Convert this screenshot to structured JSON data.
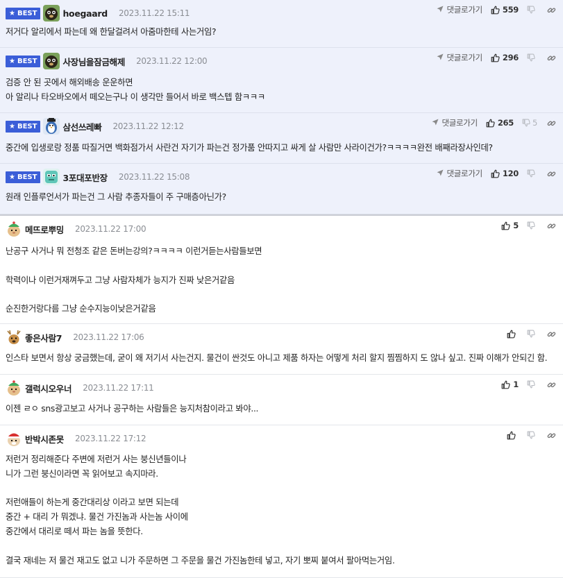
{
  "reply_label": "댓글로가기",
  "best_label": "BEST",
  "comments": [
    {
      "best": true,
      "nick": "hoegaard",
      "time": "2023.11.22 15:11",
      "likes": "559",
      "dislikes": "",
      "avatar": "dog-black",
      "lines": [
        "저거다 알리에서 파는데 왜 한달걸려서 아줌마한테 사는거임?"
      ]
    },
    {
      "best": true,
      "nick": "사장님을잠금해제",
      "time": "2023.11.22 12:00",
      "likes": "296",
      "dislikes": "",
      "avatar": "dog-black",
      "lines": [
        "검증 안 된 곳에서 해외배송 운운하면",
        "아 알리나 타오바오에서 떼오는구나 이 생각만 들어서 바로 백스텝 함ㅋㅋㅋ"
      ]
    },
    {
      "best": true,
      "nick": "삼선쓰레빠",
      "time": "2023.11.22 12:12",
      "likes": "265",
      "dislikes": "5",
      "avatar": "penguin",
      "lines": [
        "중간에 입생로랑 정품 따질거면 백화점가서 사란건 자기가 파는건 정가품 안따지고 싸게 살 사람만 사라이건가?ㅋㅋㅋㅋ완전 배째라장사인데?"
      ]
    },
    {
      "best": true,
      "nick": "3포대포반장",
      "time": "2023.11.22 15:08",
      "likes": "120",
      "dislikes": "",
      "avatar": "mint",
      "lines": [
        "원래 인플루언서가 파는건 그 사람 추종자들이 주 구매층아닌가?"
      ]
    },
    {
      "best": false,
      "nick": "메뜨로뿌밍",
      "time": "2023.11.22 17:00",
      "likes": "5",
      "dislikes": "",
      "avatar": "hamster-green",
      "lines": [
        "난공구 사거나 뭐 전청조 같은 돈버는강의?ㅋㅋㅋㅋ 이런거듣는사람들보면",
        "",
        "학력이나 이런거재껴두고 그냥 사람자체가 능지가 진짜 낮은거같음",
        "",
        "순진한거랑다름 그냥 순수지능이낮은거같음"
      ]
    },
    {
      "best": false,
      "nick": "좋은사람7",
      "time": "2023.11.22 17:06",
      "likes": "",
      "dislikes": "",
      "avatar": "deer",
      "lines": [
        "인스타 보면서 항상 궁금했는데, 굳이 왜 저기서 사는건지. 물건이 싼것도 아니고 제품 하자는 어떻게 처리 할지 찜찜하지 도 않나 싶고. 진짜 이해가 안되긴 함."
      ]
    },
    {
      "best": false,
      "nick": "갤럭시오우너",
      "time": "2023.11.22 17:11",
      "likes": "1",
      "dislikes": "",
      "avatar": "hamster-green",
      "lines": [
        "이젠 ㄹㅇ sns광고보고 사거나 공구하는 사람들은 능지처참이라고 봐야..."
      ]
    },
    {
      "best": false,
      "nick": "반박시존못",
      "time": "2023.11.22 17:12",
      "likes": "",
      "dislikes": "",
      "avatar": "santa",
      "lines": [
        "저런거 정리해준다 주변에 저런거 사는 붕신년들이나",
        "니가 그런 붕신이라면 꼭 읽어보고 속지마라.",
        "",
        "저런애들이 하는게 중간대리상 이라고 보면 되는데",
        "중간 + 대리 가 뭐겠냐. 물건 가진놈과 사는놈 사이에",
        "중간에서 대리로 떼서 파는 놈을 뜻한다.",
        "",
        "결국 재네는 저 물건 재고도 없고 니가 주문하면 그 주문을 물건 가진놈한테 넣고, 자기 뽀찌 붙여서 팔아먹는거임."
      ]
    }
  ]
}
